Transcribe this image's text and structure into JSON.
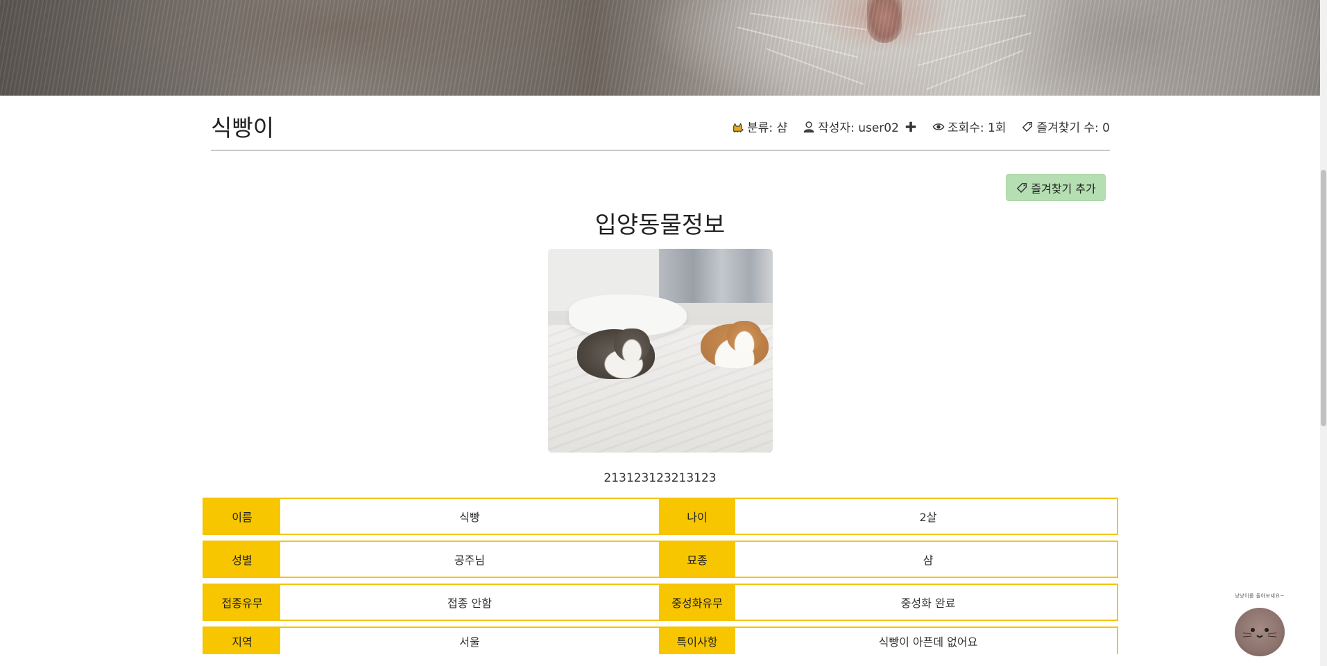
{
  "post": {
    "title": "식빵이",
    "meta": {
      "category": "분류: 샴",
      "author": "작성자: user02",
      "views": "조회수: 1회",
      "favorites": "즐겨찾기 수: 0"
    },
    "favorite_button_label": "즐겨찾기 추가"
  },
  "section_title": "입양동물정보",
  "description": "213123123213123",
  "info_rows": [
    {
      "label1": "이름",
      "value1": "식빵",
      "label2": "나이",
      "value2": "2살"
    },
    {
      "label1": "성별",
      "value1": "공주님",
      "label2": "묘종",
      "value2": "샴"
    },
    {
      "label1": "접종유무",
      "value1": "접종 안함",
      "label2": "중성화유무",
      "value2": "중성화 완료"
    },
    {
      "label1": "지역",
      "value1": "서울",
      "label2": "특이사항",
      "value2": "식빵이 아픈데 없어요"
    }
  ],
  "mascot_caption": "냥냥이를 돌아보세요~",
  "icons": {
    "category": "cat-icon",
    "author": "user-icon",
    "add_friend": "plus-icon",
    "views": "eye-icon",
    "favorites": "bookmark-tag-icon"
  },
  "colors": {
    "accent_yellow": "#f7c600",
    "favorite_button": "#b5dfb2"
  }
}
